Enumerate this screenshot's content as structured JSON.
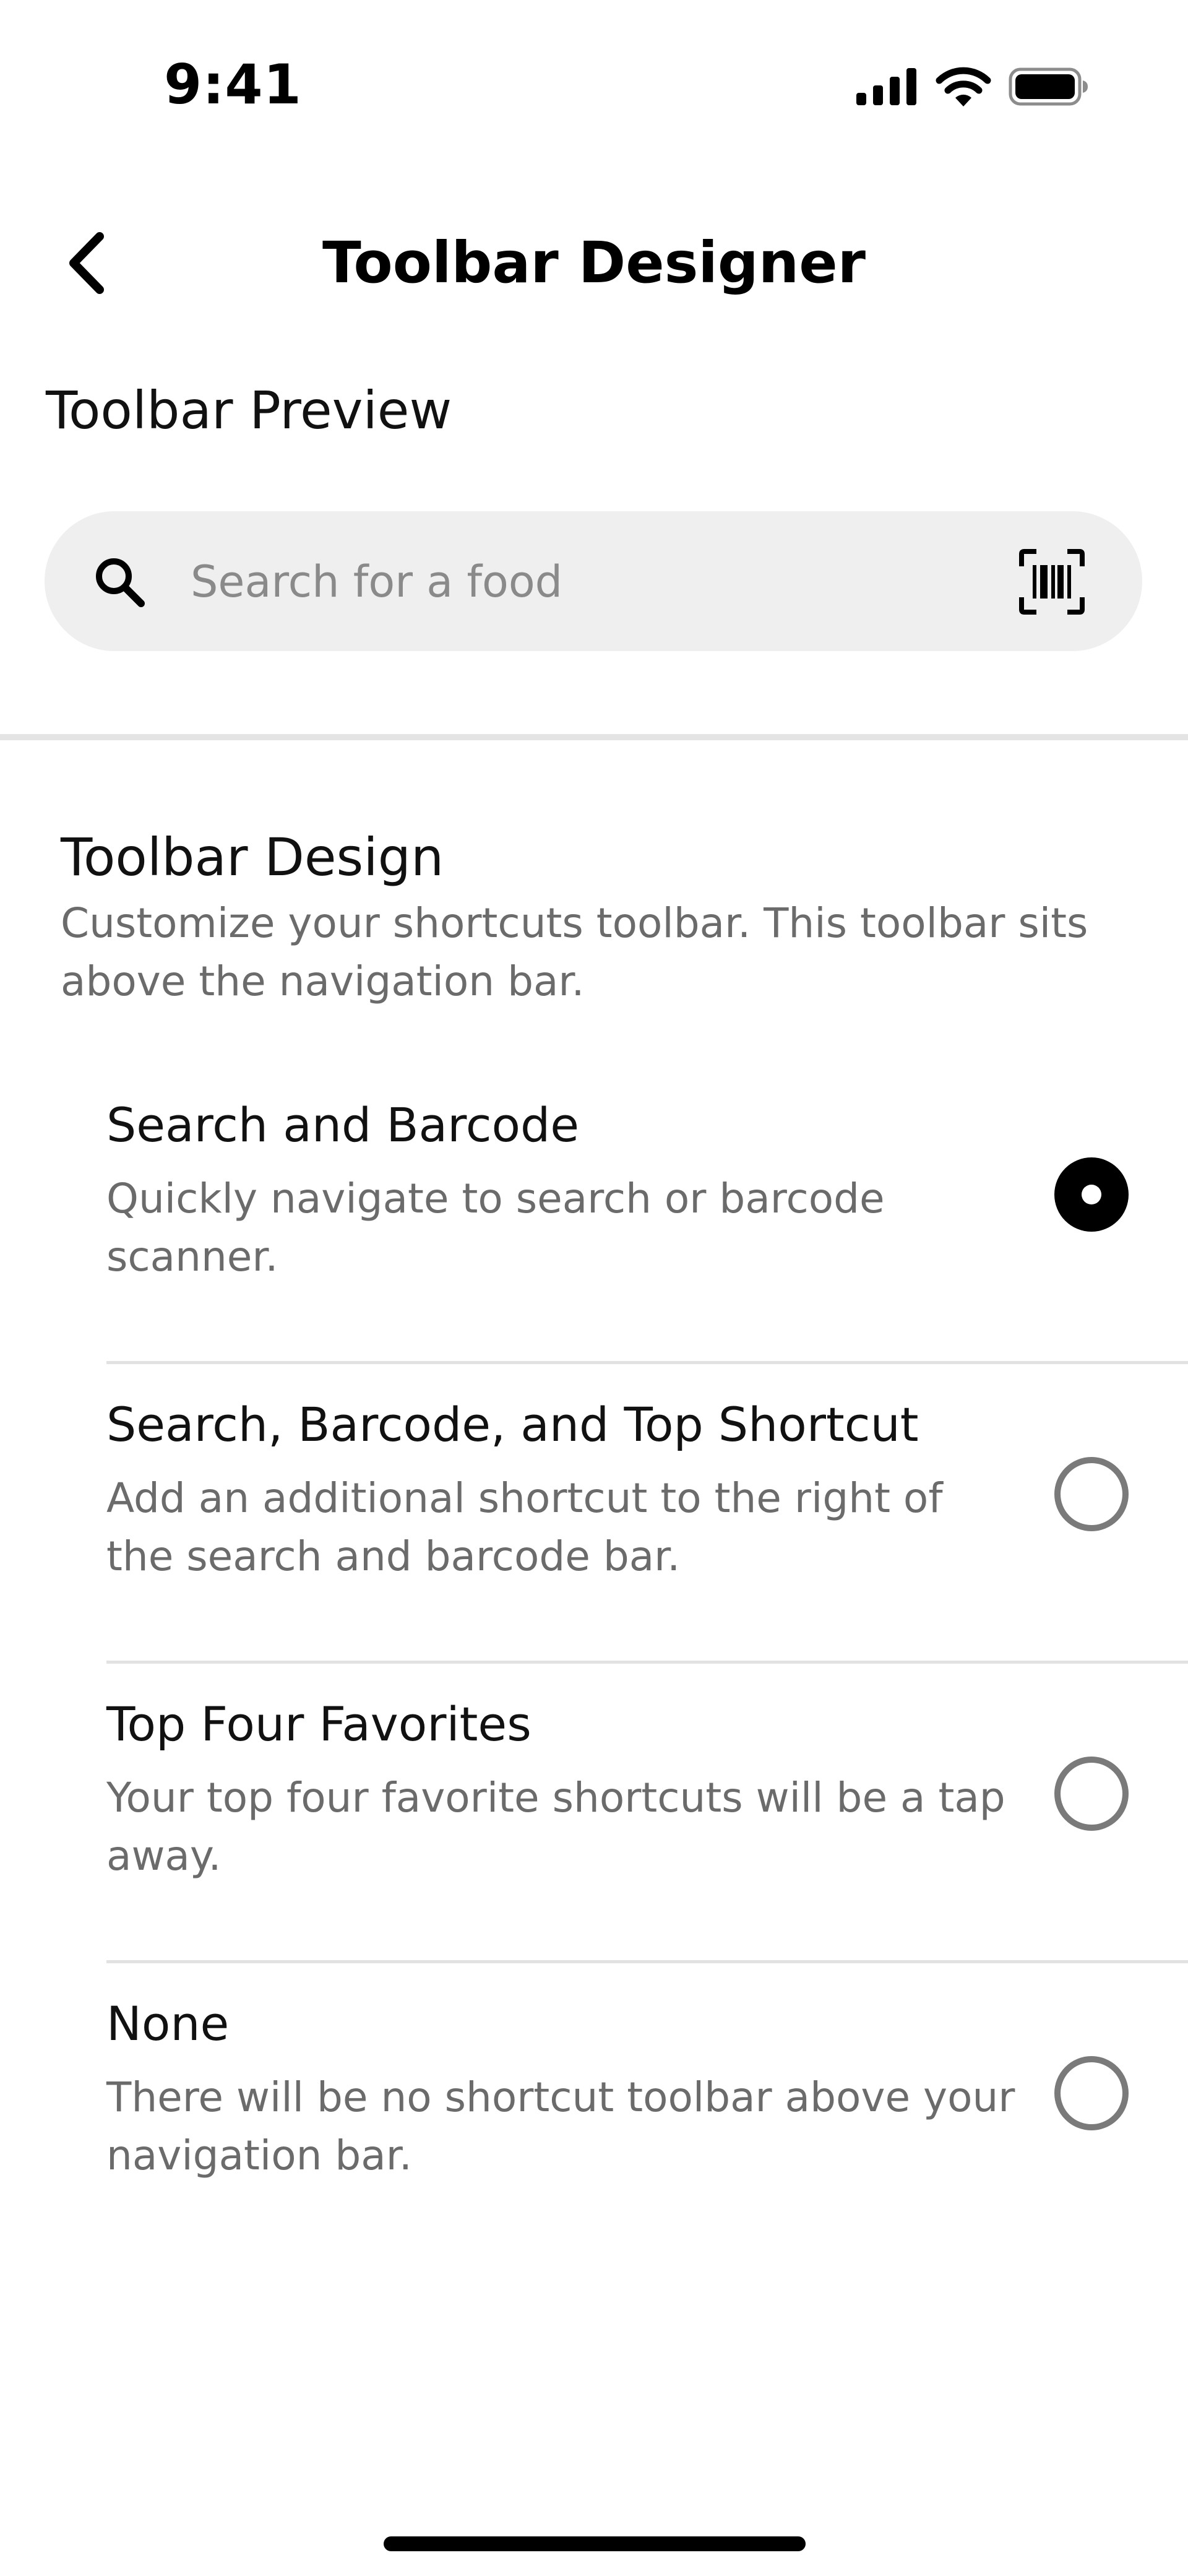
{
  "status_bar": {
    "time": "9:41",
    "icons": [
      "cellular-signal-icon",
      "wifi-icon",
      "battery-icon"
    ]
  },
  "header": {
    "back_icon": "chevron-left-icon",
    "title": "Toolbar Designer"
  },
  "preview": {
    "label": "Toolbar Preview",
    "search": {
      "placeholder": "Search for a food",
      "left_icon": "search-icon",
      "right_icon": "barcode-scan-icon"
    }
  },
  "design": {
    "title": "Toolbar Design",
    "description": "Customize your shortcuts toolbar. This toolbar sits above the navigation bar.",
    "options": [
      {
        "title": "Search and Barcode",
        "description": "Quickly navigate to search or barcode scanner.",
        "selected": true
      },
      {
        "title": "Search, Barcode, and Top Shortcut",
        "description": "Add an additional shortcut to the right of the search and barcode bar.",
        "selected": false
      },
      {
        "title": "Top Four Favorites",
        "description": "Your top four favorite shortcuts will be a tap away.",
        "selected": false
      },
      {
        "title": "None",
        "description": "There will be no shortcut toolbar above your navigation bar.",
        "selected": false
      }
    ]
  },
  "colors": {
    "text_primary": "#111111",
    "text_secondary": "#6b6b6b",
    "search_bg": "#efefef",
    "radio_selected": "#000000",
    "radio_unselected": "#7a7a7a"
  }
}
